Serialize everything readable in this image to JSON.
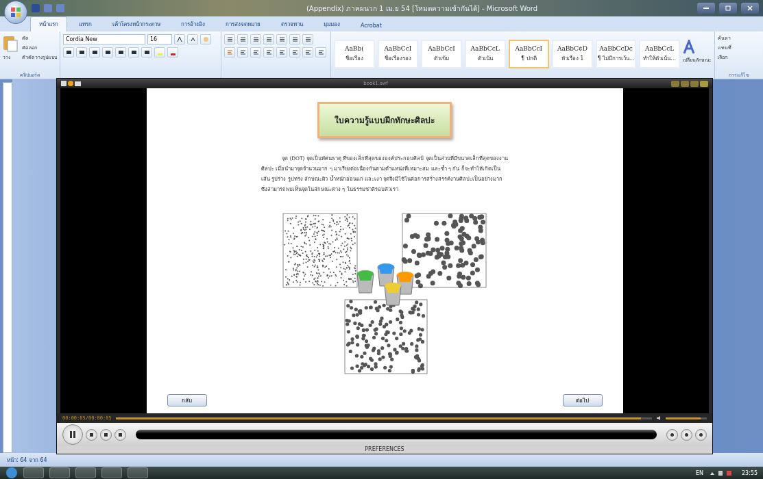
{
  "word": {
    "title": "(Appendix) ภาคผนวก 1 เม.ย 54 [โหมดความเข้ากันได้] - Microsoft Word",
    "tabs": [
      {
        "label": "หน้าแรก",
        "selected": true
      },
      {
        "label": "แทรก",
        "selected": false
      },
      {
        "label": "เค้าโครงหน้ากระดาษ",
        "selected": false
      },
      {
        "label": "การอ้างอิง",
        "selected": false
      },
      {
        "label": "การส่งจดหมาย",
        "selected": false
      },
      {
        "label": "ตรวจทาน",
        "selected": false
      },
      {
        "label": "มุมมอง",
        "selected": false
      },
      {
        "label": "Acrobat",
        "selected": false
      }
    ],
    "clipboard": {
      "paste": "วาง",
      "cut": "ตัด",
      "copy": "คัดลอก",
      "format_painter": "ตัวคัดวางรูปแบบ",
      "group": "คลิปบอร์ด"
    },
    "font": {
      "name": "Cordia New",
      "size": "16"
    },
    "styles": [
      {
        "sample": "AaBb(",
        "label": "ชื่อเรื่อง",
        "selected": false
      },
      {
        "sample": "AaBbCcI",
        "label": "ชื่อเรื่องรอง",
        "selected": false
      },
      {
        "sample": "AaBbCcI",
        "label": "ตัวเข้ม",
        "selected": false
      },
      {
        "sample": "AaBbCcL",
        "label": "ตัวเน้น",
        "selected": false
      },
      {
        "sample": "AaBbCcI",
        "label": "¶ ปกติ",
        "selected": true
      },
      {
        "sample": "AaBbC¢D",
        "label": "หัวเรื่อง 1",
        "selected": false
      },
      {
        "sample": "AaBbCcDc",
        "label": "¶ ไม่มีการเว้น...",
        "selected": false
      },
      {
        "sample": "AaBbCcL",
        "label": "ทำให้ตัวเน้น...",
        "selected": false
      }
    ],
    "change_styles": "เปลี่ยนลักษณะ",
    "editing": [
      "ค้นหา",
      "แทนที่",
      "เลือก"
    ],
    "editing_group": "การแก้ไข",
    "status": "หน้า: 64 จาก 64"
  },
  "player": {
    "title": "book1.swf",
    "heading": "ใบความรู้แบบฝึกทักษะศิลปะ",
    "paragraph": "จุด (DOT) จุดเป็นทัศนธาตุ ที่ของเล็กที่สุดขององค์ประกอบศิลป์ จุดเป็นส่วนที่มีขนาดเล็กที่สุดของงานศิลปะ เมื่อนำมาจุดจำนวนมาก ๆ มาเรียงต่อเนื่องกันตามตำแหน่งที่เหมาะสม และซ้ำ ๆ กัน ก็จะทำให้เกิดเป็นเส้น รูปร่าง รูปทรง ลักษณะผิว น้ำหนักอ่อนแก่ และเงา จุดจึงมีใช้ในต่อการสร้างสรรค์งานศิลปะเป็นอย่างมาก ซึ่งสามารถพบเห็นจุดในลักษณะต่าง ๆ ในธรรมชาติรอบตัวเรา",
    "back": "กลับ",
    "next": "ต่อไป",
    "time": "00:00:05/00:00:05",
    "seek": {
      "level": 0.98
    },
    "volume": {
      "level": 0.85
    },
    "preferences": "PREFERENCES"
  },
  "taskbar": {
    "language": "EN",
    "clock": "23:55"
  }
}
